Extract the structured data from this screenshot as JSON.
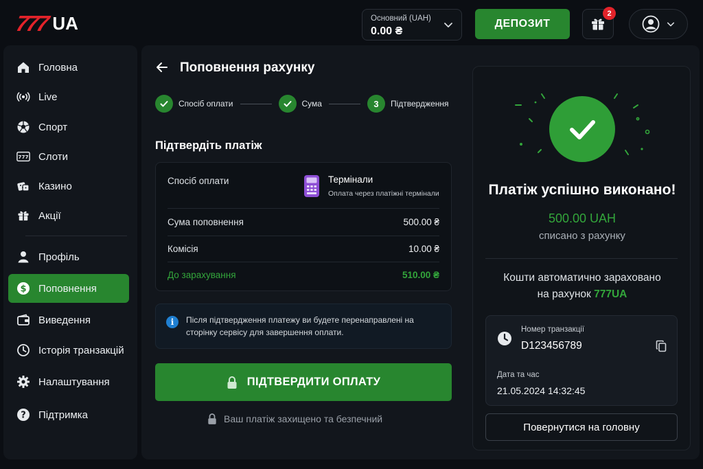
{
  "header": {
    "logo_number": "777",
    "logo_suffix": "UA",
    "balance_label": "Основний (UAH)",
    "balance_value": "0.00 ₴",
    "deposit_label": "ДЕПОЗИТ",
    "gift_badge_count": "2",
    "icons": [
      "chevron-down-icon",
      "gift-icon",
      "user-icon"
    ]
  },
  "sidebar": {
    "items": [
      {
        "label": "Головна",
        "icon": "home-icon"
      },
      {
        "label": "Live",
        "icon": "live-icon"
      },
      {
        "label": "Спорт",
        "icon": "soccer-ball-icon"
      },
      {
        "label": "Слоти",
        "icon": "slots-icon"
      },
      {
        "label": "Казино",
        "icon": "dice-icon"
      },
      {
        "label": "Акції",
        "icon": "gift-icon"
      },
      {
        "label": "Профіль",
        "icon": "user-icon"
      },
      {
        "label": "Поповнення",
        "icon": "dollar-icon",
        "active": true
      },
      {
        "label": "Виведення",
        "icon": "wallet-icon"
      },
      {
        "label": "Історія транзакцій",
        "icon": "history-icon"
      },
      {
        "label": "Налаштування",
        "icon": "gear-icon"
      },
      {
        "label": "Підтримка",
        "icon": "help-icon"
      }
    ]
  },
  "main": {
    "title": "Поповнення рахунку",
    "steps": [
      {
        "label": "Спосіб оплати",
        "state": "done"
      },
      {
        "label": "Сума",
        "state": "done"
      },
      {
        "number": "3",
        "label": "Підтвердження",
        "state": "current"
      }
    ],
    "section_title": "Підтвердіть платіж",
    "summary": {
      "method_label": "Спосіб оплати",
      "method_name": "Термінали",
      "method_desc": "Оплата через платіжні термінали",
      "amount_label": "Сума поповнення",
      "amount_value": "500.00 ₴",
      "fee_label": "Комісія",
      "fee_value": "10.00 ₴",
      "total_label": "До зарахування",
      "total_value": "510.00 ₴"
    },
    "info_text": "Після підтвердження платежу ви будете перенаправлені на сторінку сервісу для завершення оплати.",
    "info_icon_glyph": "i",
    "confirm_label": "ПІДТВЕРДИТИ ОПЛАТУ",
    "secure_note": "Ваш платіж захищено та безпечний"
  },
  "success": {
    "title": "Платіж успішно виконано!",
    "amount": "500.00 UAH",
    "subtitle": "списано з рахунку",
    "credited_prefix": "Кошти автоматично зараховано",
    "credited_line2": "на рахунок",
    "credited_brand": "777UA",
    "tx_label": "Номер транзакції",
    "tx_id": "D123456789",
    "date_label": "Дата та час",
    "date_value": "21.05.2024 14:32:45",
    "home_button": "Повернутися на головну"
  },
  "colors": {
    "accent_green": "#28862f",
    "text_green": "#33a63b",
    "brand_red": "#e3232a",
    "background": "#0b0e13",
    "panel": "#12161c",
    "info_blue": "#1f7fd1",
    "terminal_purple": "#8e4fd6"
  }
}
